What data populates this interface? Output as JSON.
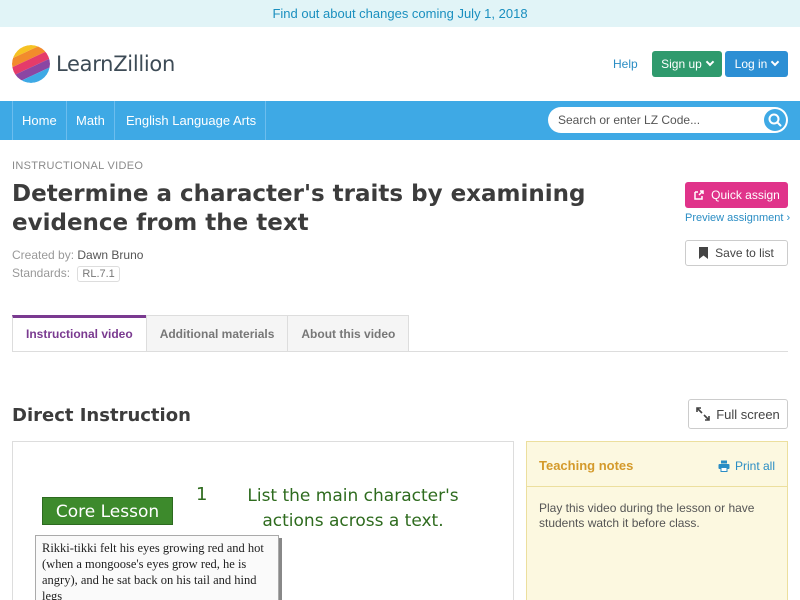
{
  "announcement": "Find out about changes coming July 1, 2018",
  "header": {
    "logo_text": "LearnZillion",
    "help": "Help",
    "signup": "Sign up",
    "login": "Log in"
  },
  "nav": {
    "items": [
      "Home",
      "Math",
      "English Language Arts"
    ],
    "search_placeholder": "Search or enter LZ Code..."
  },
  "lesson": {
    "eyebrow": "INSTRUCTIONAL VIDEO",
    "title": "Determine a character's traits by examining evidence from the text",
    "created_by_label": "Created by:",
    "author": "Dawn Bruno",
    "standards_label": "Standards:",
    "standard": "RL.7.1"
  },
  "actions": {
    "quick_assign": "Quick assign",
    "preview": "Preview assignment ›",
    "save": "Save to list"
  },
  "tabs": [
    "Instructional video",
    "Additional materials",
    "About this video"
  ],
  "section": {
    "title": "Direct Instruction",
    "fullscreen": "Full screen"
  },
  "video": {
    "badge": "Core Lesson",
    "step_number": "1",
    "step_text": "List the main character's actions across a text.",
    "excerpt": "Rikki-tikki felt his eyes growing red and hot (when a mongoose's eyes grow red, he is angry), and he sat back on his tail and hind legs"
  },
  "notes": {
    "title": "Teaching notes",
    "print": "Print all",
    "body": "Play this video during the lesson or have students watch it before class."
  },
  "colors": {
    "nav": "#3ea9e5",
    "signup": "#2f9a6d",
    "login": "#2c8fd4",
    "assign": "#e0338a",
    "tab_active": "#7a3a90"
  }
}
